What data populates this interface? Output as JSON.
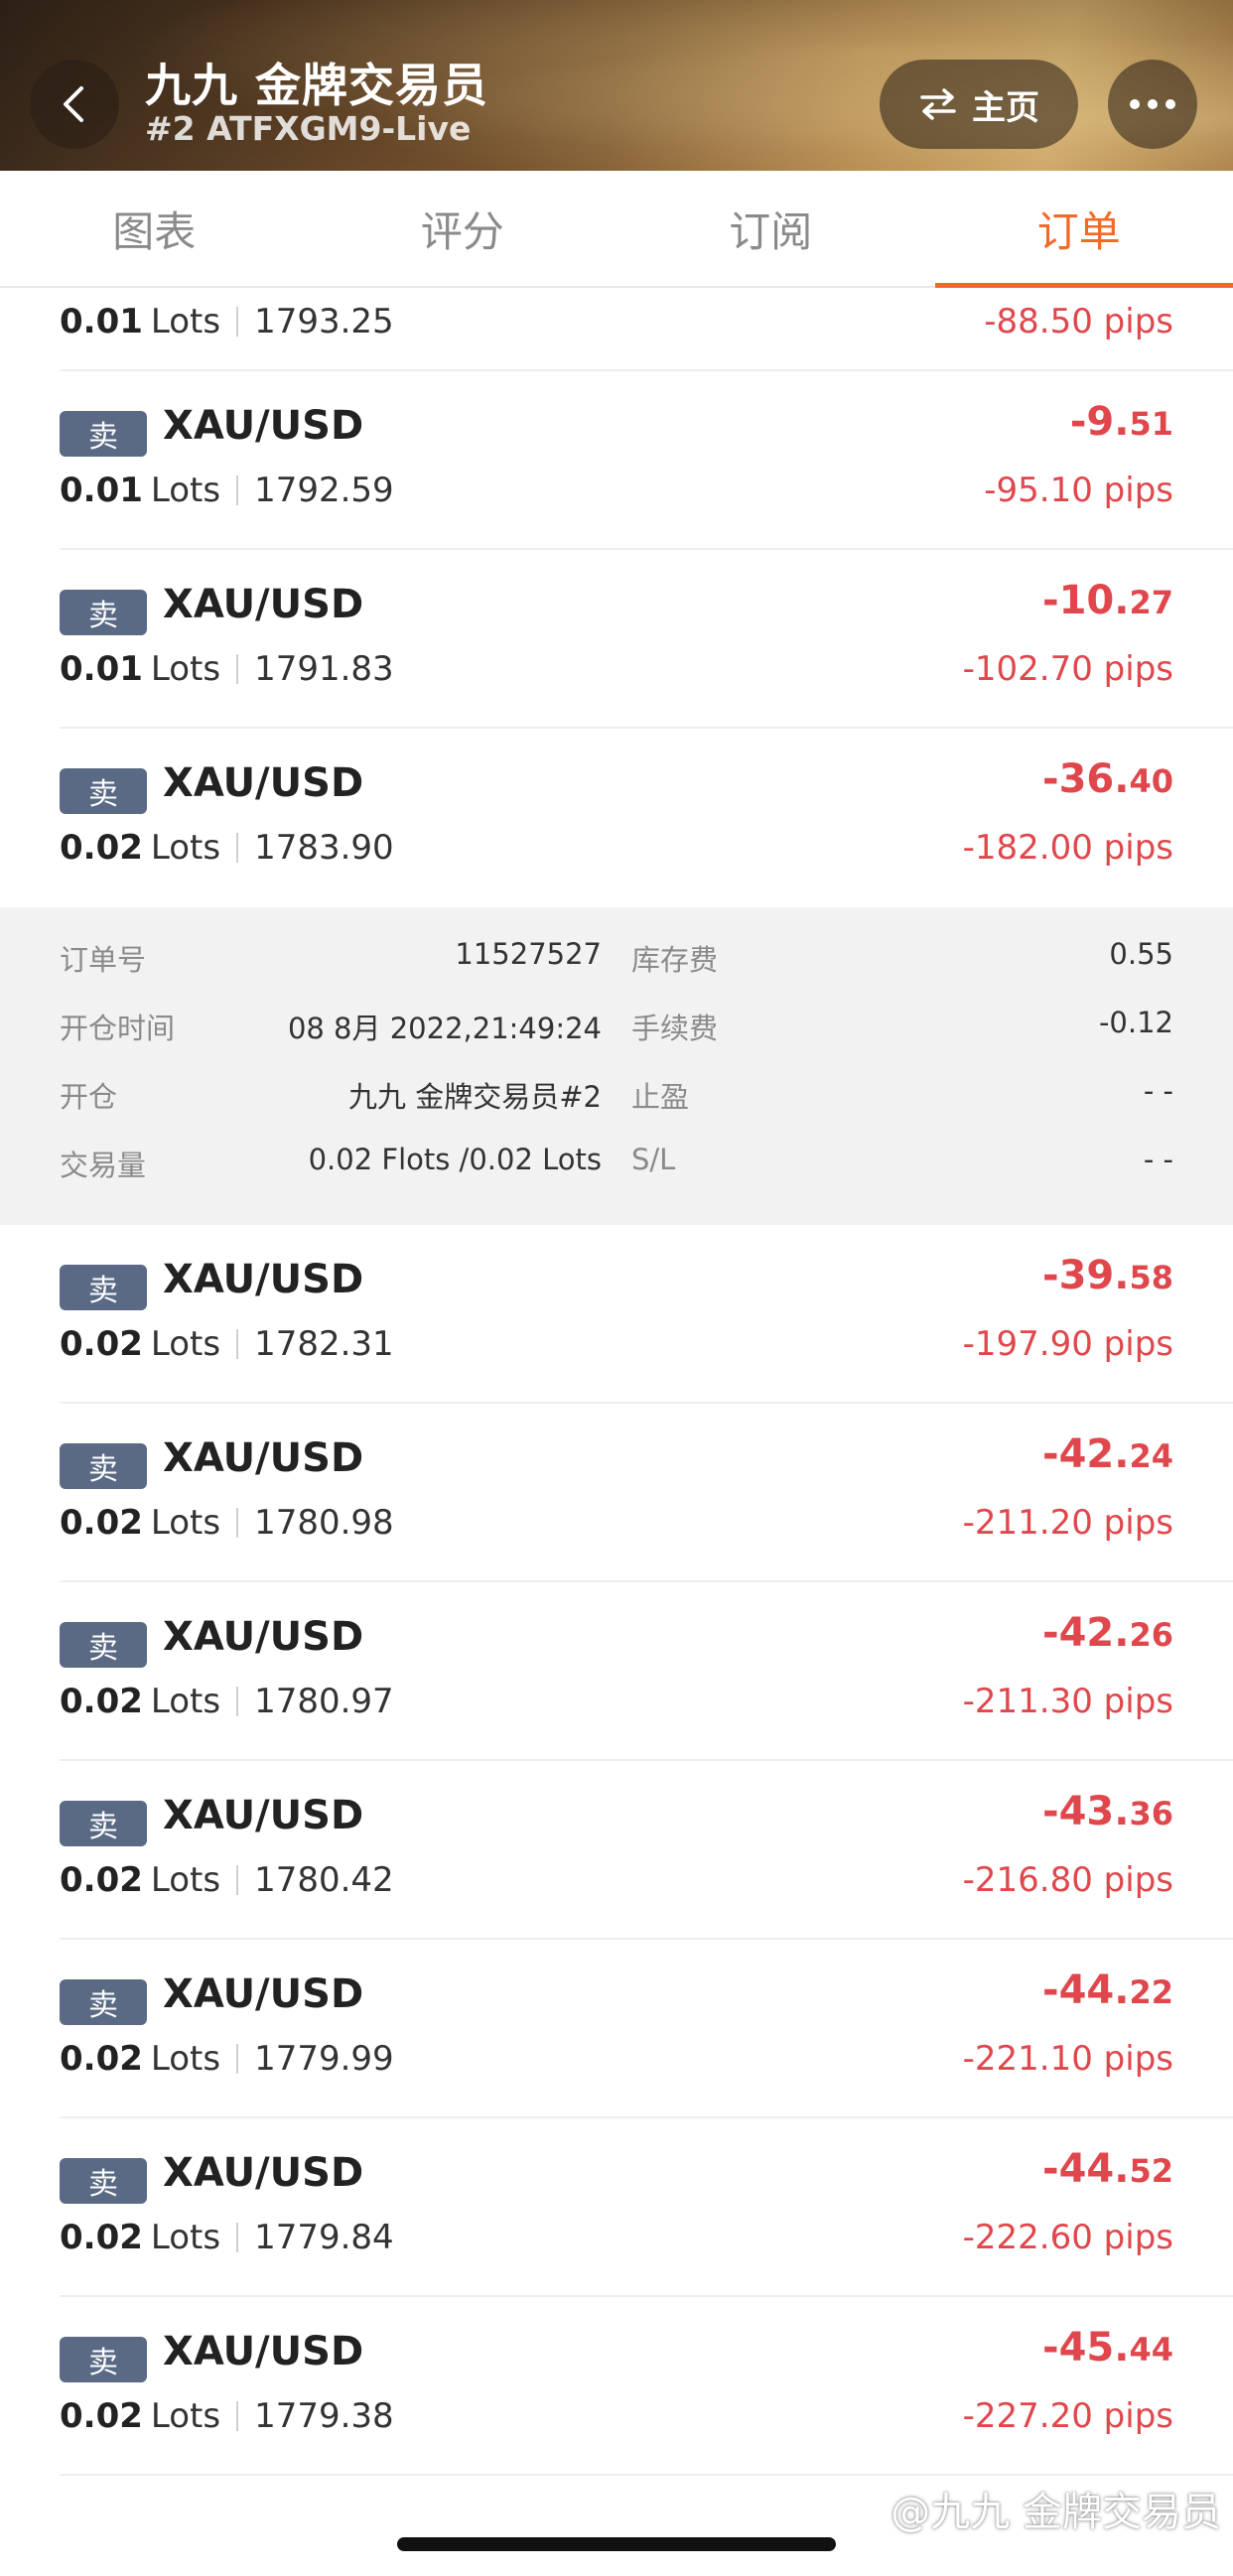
{
  "header": {
    "title": "九九 金牌交易员",
    "subtitle": "#2 ATFXGM9-Live",
    "home_label": "主页"
  },
  "tabs": [
    {
      "label": "图表"
    },
    {
      "label": "评分"
    },
    {
      "label": "订阅"
    },
    {
      "label": "订单",
      "active": true
    }
  ],
  "colors": {
    "accent": "#f26a2a",
    "loss": "#e0474c",
    "badge": "#5a6a84"
  },
  "orders_top": [
    {
      "lots": "0.01",
      "lots_unit": "Lots",
      "price": "1793.25",
      "pips": "-88.50 pips"
    },
    {
      "side": "卖",
      "symbol": "XAU/USD",
      "lots": "0.01",
      "lots_unit": "Lots",
      "price": "1792.59",
      "profit_main": "-9.",
      "profit_decimal": "51",
      "pips": "-95.10 pips"
    },
    {
      "side": "卖",
      "symbol": "XAU/USD",
      "lots": "0.01",
      "lots_unit": "Lots",
      "price": "1791.83",
      "profit_main": "-10.",
      "profit_decimal": "27",
      "pips": "-102.70 pips"
    },
    {
      "side": "卖",
      "symbol": "XAU/USD",
      "lots": "0.02",
      "lots_unit": "Lots",
      "price": "1783.90",
      "profit_main": "-36.",
      "profit_decimal": "40",
      "pips": "-182.00 pips"
    }
  ],
  "detail": {
    "order_no_label": "订单号",
    "order_no": "11527527",
    "swap_label": "库存费",
    "swap": "0.55",
    "open_time_label": "开仓时间",
    "open_time": "08 8月 2022,21:49:24",
    "commission_label": "手续费",
    "commission": "-0.12",
    "open_label": "开仓",
    "open_by": "九九 金牌交易员#2",
    "tp_label": "止盈",
    "tp": "- -",
    "volume_label": "交易量",
    "volume": "0.02 Flots /0.02 Lots",
    "sl_label": "S/L",
    "sl": "- -"
  },
  "orders_bottom": [
    {
      "side": "卖",
      "symbol": "XAU/USD",
      "lots": "0.02",
      "lots_unit": "Lots",
      "price": "1782.31",
      "profit_main": "-39.",
      "profit_decimal": "58",
      "pips": "-197.90 pips"
    },
    {
      "side": "卖",
      "symbol": "XAU/USD",
      "lots": "0.02",
      "lots_unit": "Lots",
      "price": "1780.98",
      "profit_main": "-42.",
      "profit_decimal": "24",
      "pips": "-211.20 pips"
    },
    {
      "side": "卖",
      "symbol": "XAU/USD",
      "lots": "0.02",
      "lots_unit": "Lots",
      "price": "1780.97",
      "profit_main": "-42.",
      "profit_decimal": "26",
      "pips": "-211.30 pips"
    },
    {
      "side": "卖",
      "symbol": "XAU/USD",
      "lots": "0.02",
      "lots_unit": "Lots",
      "price": "1780.42",
      "profit_main": "-43.",
      "profit_decimal": "36",
      "pips": "-216.80 pips"
    },
    {
      "side": "卖",
      "symbol": "XAU/USD",
      "lots": "0.02",
      "lots_unit": "Lots",
      "price": "1779.99",
      "profit_main": "-44.",
      "profit_decimal": "22",
      "pips": "-221.10 pips"
    },
    {
      "side": "卖",
      "symbol": "XAU/USD",
      "lots": "0.02",
      "lots_unit": "Lots",
      "price": "1779.84",
      "profit_main": "-44.",
      "profit_decimal": "52",
      "pips": "-222.60 pips"
    },
    {
      "side": "卖",
      "symbol": "XAU/USD",
      "lots": "0.02",
      "lots_unit": "Lots",
      "price": "1779.38",
      "profit_main": "-45.",
      "profit_decimal": "44",
      "pips": "-227.20 pips"
    }
  ],
  "watermark": "@九九 金牌交易员"
}
